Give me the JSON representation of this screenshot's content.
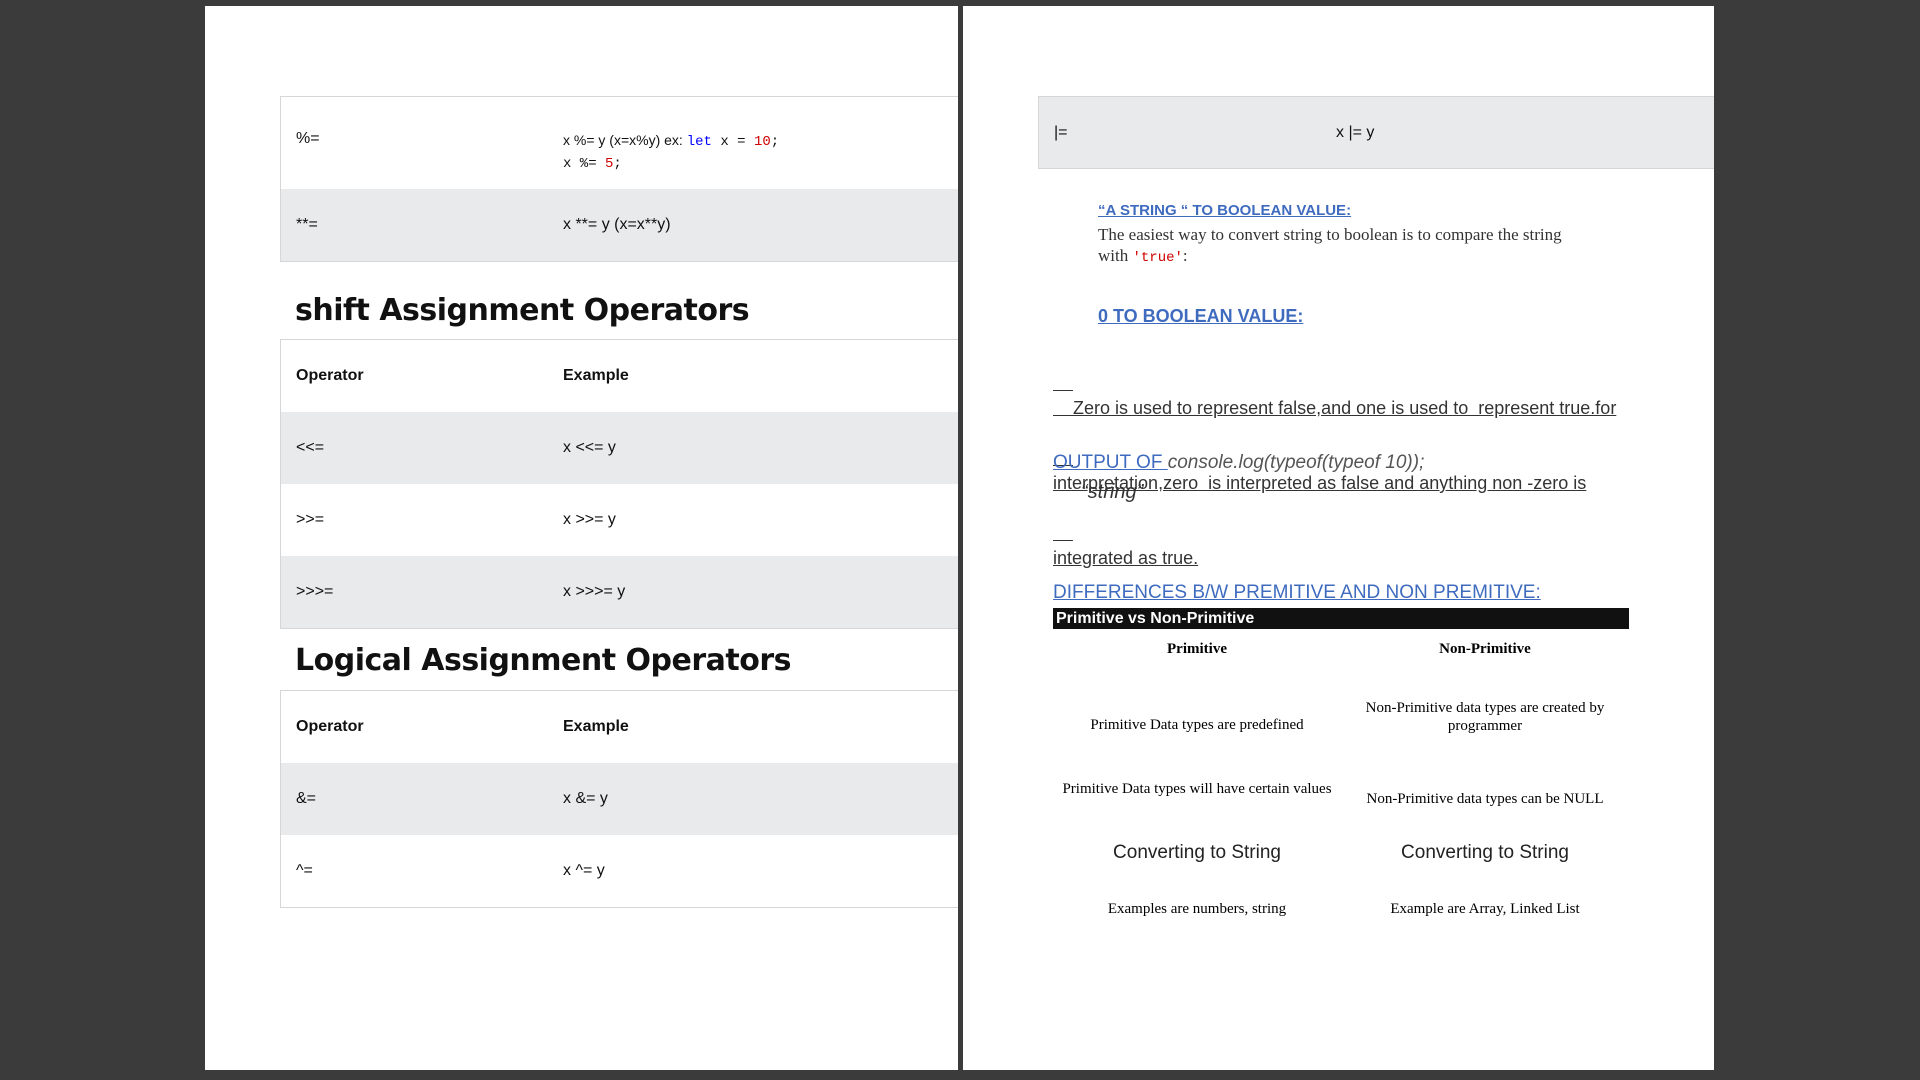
{
  "left_page": {
    "table_top": [
      {
        "operator": "%=",
        "ex_plain": "x %= y (x=x%y) ex: ",
        "ex_kw": "let",
        "ex_mid": " x = ",
        "ex_num": "10",
        "ex_end": ";",
        "ex_line2_a": "x %= ",
        "ex_line2_num": "5",
        "ex_line2_end": ";"
      },
      {
        "operator": "**=",
        "example": "x **= y (x=x**y)"
      }
    ],
    "shift_title": "shift Assignment Operators",
    "shift_table": {
      "header": {
        "operator": "Operator",
        "example": "Example"
      },
      "rows": [
        {
          "operator": "<<=",
          "example": "x <<= y"
        },
        {
          "operator": ">>=",
          "example": "x >>= y"
        },
        {
          "operator": ">>>=",
          "example": "x >>>= y"
        }
      ]
    },
    "logical_title": "Logical Assignment Operators",
    "logical_table": {
      "header": {
        "operator": "Operator",
        "example": "Example"
      },
      "rows": [
        {
          "operator": "&=",
          "example": "x &= y"
        },
        {
          "operator": "^=",
          "example": "x ^= y"
        }
      ]
    }
  },
  "right_page": {
    "top_row": {
      "operator": "|=",
      "example": "x |= y"
    },
    "string_heading": "“A STRING “ TO BOOLEAN VALUE:",
    "string_text_1": "The easiest way to convert string to boolean is to compare the string",
    "string_text_2a": "with ",
    "string_text_code": "'true'",
    "string_text_2b": ":",
    "zero_heading": "0 TO BOOLEAN VALUE:",
    "zero_text_1": "    Zero is used to represent false,and one is used to  represent true.for",
    "zero_text_2": "interpretation,zero  is interpreted as false and anything non -zero is",
    "zero_text_3": "integrated as true.",
    "output_label": "OUTPUT OF ",
    "output_code": "console.log(typeof(typeof 10));",
    "output_result": "“string”",
    "diff_heading": "DIFFERENCES B/W PREMITIVE AND NON PREMITIVE:",
    "compare": {
      "caption": "Primitive vs Non-Primitive",
      "headers": [
        "Primitive",
        "Non-Primitive"
      ],
      "rows": [
        [
          "Primitive Data types are predefined",
          "Non-Primitive data types are created by programmer"
        ],
        [
          "Primitive Data types will have certain values",
          "Non-Primitive data types can be NULL"
        ],
        [
          "Converting to String",
          "Converting to String"
        ],
        [
          "Examples are numbers, string",
          "Example are Array, Linked List"
        ]
      ]
    }
  }
}
